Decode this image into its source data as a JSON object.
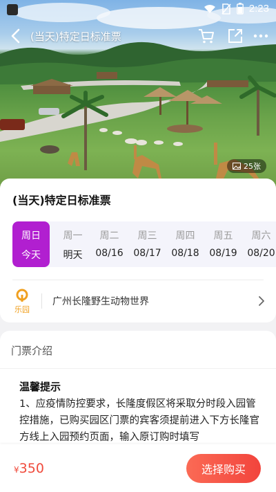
{
  "status_bar": {
    "time": "2:23",
    "icons": [
      "wifi-icon",
      "no-sim-icon",
      "battery-icon"
    ]
  },
  "nav": {
    "title": "(当天)特定日标准票",
    "icons": [
      "back-icon",
      "cart-icon",
      "share-icon",
      "more-icon"
    ]
  },
  "hero": {
    "photo_count": "25张",
    "photo_icon": "image-icon"
  },
  "ticket": {
    "title": "(当天)特定日标准票",
    "days": [
      {
        "weekday": "周日",
        "date": "今天",
        "selected": true
      },
      {
        "weekday": "周一",
        "date": "明天",
        "selected": false
      },
      {
        "weekday": "周二",
        "date": "08/16",
        "selected": false
      },
      {
        "weekday": "周三",
        "date": "08/17",
        "selected": false
      },
      {
        "weekday": "周四",
        "date": "08/18",
        "selected": false
      },
      {
        "weekday": "周五",
        "date": "08/19",
        "selected": false
      },
      {
        "weekday": "周六",
        "date": "08/20",
        "selected": false
      }
    ],
    "park": {
      "logo_text": "乐园",
      "name": "广州长隆野生动物世界"
    }
  },
  "intro": {
    "title": "门票介绍",
    "tip_title": "温馨提示",
    "tip_body": "1、应疫情防控要求，长隆度假区将采取分时段入园管控措施，已购买园区门票的宾客须提前进入下方长隆官方线上入园预约页面，输入原订购时填写"
  },
  "purchase": {
    "currency": "¥",
    "price": "350",
    "button_label": "选择购买"
  },
  "colors": {
    "accent_purple": "#b11fd0",
    "price_red": "#f04a3b",
    "button_red": "#f2443c",
    "logo_orange": "#f0a020"
  }
}
